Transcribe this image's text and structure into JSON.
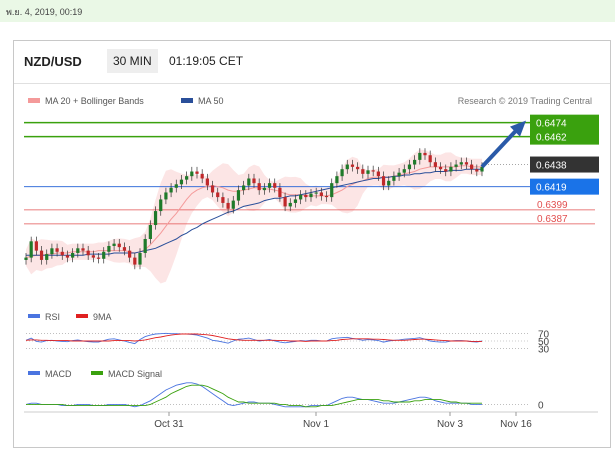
{
  "header_bar": {
    "timestamp": "พ.ย. 4, 2019, 00:19"
  },
  "panel_header": {
    "pair": "NZD/USD",
    "timeframe": "30 MIN",
    "time": "01:19:05 CET"
  },
  "colors": {
    "resistance_line": "#3aa10e",
    "level_label_green": "#3aa10e",
    "current_label": "#333333",
    "support_line": "#1f5fd6",
    "pivot_label": "#1a73e8",
    "red_level": "#e25050",
    "ma20_band": "#f49a9a",
    "ma50": "#2a4f9a",
    "candle_up": "#1f7a2a",
    "candle_down": "#c0282a",
    "rsi": "#4a74e0",
    "rsi_ma": "#e02020",
    "macd": "#4a74e0",
    "macd_signal": "#3aa10e",
    "arrow": "#2a5aa8"
  },
  "chart_data": {
    "type": "candlestick",
    "title": "NZD/USD",
    "legend": [
      "MA 20 + Bollinger Bands",
      "MA 50"
    ],
    "credit": "Research © 2019 Trading Central",
    "x_ticks": [
      "Oct 31",
      "Nov 1",
      "Nov 3",
      "Nov 16"
    ],
    "price_levels": [
      {
        "value": 0.6474,
        "label": "0.6474",
        "style": "green-line-label"
      },
      {
        "value": 0.6462,
        "label": "0.6462",
        "style": "green-line-label"
      },
      {
        "value": 0.6438,
        "label": "0.6438",
        "style": "current-dark-label"
      },
      {
        "value": 0.6419,
        "label": "0.6419",
        "style": "blue-line-label"
      },
      {
        "value": 0.6399,
        "label": "0.6399",
        "style": "red-line-text"
      },
      {
        "value": 0.6387,
        "label": "0.6387",
        "style": "red-line-text"
      }
    ],
    "price_range": [
      0.6325,
      0.6478
    ],
    "close": [
      0.6358,
      0.6372,
      0.6364,
      0.6356,
      0.6361,
      0.6366,
      0.6363,
      0.636,
      0.6358,
      0.6362,
      0.6366,
      0.6364,
      0.636,
      0.6358,
      0.6357,
      0.6363,
      0.6368,
      0.637,
      0.6367,
      0.6364,
      0.6358,
      0.6352,
      0.6362,
      0.6374,
      0.6386,
      0.6398,
      0.6408,
      0.6414,
      0.6418,
      0.6421,
      0.6425,
      0.6428,
      0.6432,
      0.643,
      0.6426,
      0.642,
      0.6414,
      0.641,
      0.6405,
      0.64,
      0.6407,
      0.6416,
      0.642,
      0.6426,
      0.6422,
      0.6416,
      0.6418,
      0.6422,
      0.6418,
      0.641,
      0.6402,
      0.6405,
      0.6408,
      0.6412,
      0.641,
      0.6413,
      0.6414,
      0.6411,
      0.641,
      0.6422,
      0.6428,
      0.6434,
      0.6438,
      0.6436,
      0.6434,
      0.643,
      0.6433,
      0.6432,
      0.6428,
      0.642,
      0.6424,
      0.6428,
      0.6431,
      0.6434,
      0.6438,
      0.6442,
      0.6448,
      0.6446,
      0.644,
      0.6436,
      0.6434,
      0.6432,
      0.6436,
      0.6438,
      0.644,
      0.6438,
      0.6434,
      0.6432,
      0.6436
    ],
    "ma20": [
      0.6358,
      0.6359,
      0.636,
      0.636,
      0.6361,
      0.6361,
      0.6362,
      0.6362,
      0.6362,
      0.6363,
      0.6363,
      0.6363,
      0.6363,
      0.6363,
      0.6364,
      0.6364,
      0.6364,
      0.6364,
      0.6364,
      0.6364,
      0.6363,
      0.6362,
      0.6363,
      0.6365,
      0.6369,
      0.6374,
      0.6379,
      0.6385,
      0.6391,
      0.6396,
      0.6402,
      0.6408,
      0.6413,
      0.6416,
      0.6418,
      0.6419,
      0.642,
      0.6419,
      0.6418,
      0.6416,
      0.6415,
      0.6415,
      0.6416,
      0.6417,
      0.6418,
      0.6418,
      0.6417,
      0.6417,
      0.6416,
      0.6415,
      0.6413,
      0.6412,
      0.6412,
      0.6412,
      0.6411,
      0.6411,
      0.6411,
      0.6411,
      0.6411,
      0.6412,
      0.6414,
      0.6416,
      0.6419,
      0.6421,
      0.6423,
      0.6424,
      0.6426,
      0.6427,
      0.6427,
      0.6427,
      0.6427,
      0.6428,
      0.6429,
      0.643,
      0.6431,
      0.6432,
      0.6434,
      0.6435,
      0.6436,
      0.6436,
      0.6436,
      0.6436,
      0.6436,
      0.6436,
      0.6437,
      0.6437,
      0.6436,
      0.6436,
      0.6436
    ],
    "ma50": [
      0.636,
      0.636,
      0.636,
      0.636,
      0.636,
      0.636,
      0.636,
      0.636,
      0.636,
      0.636,
      0.636,
      0.636,
      0.6361,
      0.6361,
      0.6361,
      0.6361,
      0.6361,
      0.6362,
      0.6362,
      0.6362,
      0.6362,
      0.6362,
      0.6363,
      0.6364,
      0.6365,
      0.6366,
      0.6368,
      0.637,
      0.6372,
      0.6374,
      0.6377,
      0.6379,
      0.6382,
      0.6384,
      0.6387,
      0.6389,
      0.6391,
      0.6393,
      0.6395,
      0.6397,
      0.6398,
      0.64,
      0.6402,
      0.6403,
      0.6404,
      0.6405,
      0.6407,
      0.6408,
      0.6409,
      0.6409,
      0.641,
      0.6411,
      0.6411,
      0.6412,
      0.6413,
      0.6414,
      0.6415,
      0.6416,
      0.6417,
      0.6418,
      0.6419,
      0.642,
      0.6421,
      0.6422,
      0.6423,
      0.6424,
      0.6425,
      0.6426,
      0.6426,
      0.6427,
      0.6427,
      0.6428,
      0.6428,
      0.6429,
      0.6429,
      0.643,
      0.643,
      0.6431,
      0.6431,
      0.6432,
      0.6432,
      0.6432,
      0.6433,
      0.6433,
      0.6433,
      0.6434,
      0.6434,
      0.6434,
      0.6434
    ],
    "forecast_target": 0.6474,
    "rsi": {
      "legend": [
        "RSI",
        "9MA"
      ],
      "levels": [
        "70",
        "50",
        "30"
      ],
      "range": [
        20,
        80
      ],
      "values": [
        52,
        58,
        49,
        47,
        51,
        52,
        50,
        49,
        48,
        51,
        53,
        50,
        48,
        47,
        47,
        51,
        55,
        56,
        53,
        50,
        46,
        43,
        54,
        62,
        66,
        69,
        70,
        71,
        70,
        70,
        69,
        69,
        68,
        66,
        62,
        58,
        52,
        50,
        47,
        44,
        50,
        55,
        56,
        58,
        54,
        50,
        52,
        54,
        50,
        47,
        45,
        47,
        49,
        51,
        50,
        52,
        52,
        50,
        50,
        56,
        58,
        59,
        60,
        57,
        55,
        52,
        54,
        53,
        51,
        47,
        50,
        52,
        53,
        55,
        56,
        57,
        59,
        55,
        50,
        48,
        47,
        47,
        50,
        51,
        51,
        50,
        48,
        47,
        50
      ],
      "ma_values": [
        52,
        53,
        53,
        52,
        52,
        51,
        51,
        51,
        51,
        50,
        50,
        50,
        50,
        50,
        50,
        50,
        50,
        51,
        51,
        51,
        51,
        50,
        51,
        53,
        56,
        59,
        61,
        64,
        66,
        68,
        69,
        69,
        69,
        69,
        68,
        67,
        65,
        62,
        59,
        56,
        54,
        53,
        52,
        52,
        52,
        52,
        52,
        52,
        52,
        51,
        51,
        50,
        50,
        50,
        49,
        50,
        50,
        50,
        50,
        51,
        52,
        54,
        55,
        56,
        56,
        56,
        56,
        55,
        55,
        54,
        53,
        52,
        52,
        52,
        53,
        54,
        55,
        55,
        54,
        53,
        52,
        51,
        50,
        50,
        50,
        50,
        49,
        49,
        49
      ]
    },
    "macd": {
      "legend": [
        "MACD",
        "MACD Signal"
      ],
      "levels": [
        "0"
      ],
      "range": [
        -0.0008,
        0.0022
      ],
      "values": [
        0.0,
        0.0001,
        0.0001,
        0.0,
        0.0,
        0.0,
        0.0,
        -0.0001,
        -0.0001,
        -0.0001,
        0.0,
        0.0,
        0.0,
        -0.0001,
        -0.0001,
        -0.0001,
        0.0,
        0.0,
        0.0,
        0.0,
        -0.0001,
        -0.0002,
        -0.0001,
        0.0001,
        0.0003,
        0.0006,
        0.0009,
        0.0012,
        0.0014,
        0.0016,
        0.0017,
        0.0018,
        0.0018,
        0.0017,
        0.0015,
        0.0012,
        0.0009,
        0.0006,
        0.0003,
        0.0,
        -0.0001,
        0.0,
        0.0001,
        0.0002,
        0.0002,
        0.0001,
        0.0001,
        0.0001,
        0.0,
        -0.0001,
        -0.0002,
        -0.0002,
        -0.0002,
        -0.0002,
        -0.0002,
        -0.0001,
        -0.0001,
        -0.0001,
        -0.0001,
        0.0001,
        0.0003,
        0.0005,
        0.0006,
        0.0006,
        0.0005,
        0.0004,
        0.0004,
        0.0003,
        0.0002,
        0.0001,
        0.0001,
        0.0001,
        0.0002,
        0.0003,
        0.0004,
        0.0005,
        0.0006,
        0.0006,
        0.0005,
        0.0003,
        0.0002,
        0.0001,
        0.0001,
        0.0001,
        0.0001,
        0.0001,
        0.0,
        0.0,
        0.0
      ],
      "signal": [
        0.0,
        0.0,
        0.0,
        0.0,
        0.0,
        0.0,
        0.0,
        0.0,
        -0.0001,
        -0.0001,
        -0.0001,
        -0.0001,
        -0.0001,
        -0.0001,
        -0.0001,
        -0.0001,
        -0.0001,
        -0.0001,
        -0.0001,
        -0.0001,
        -0.0001,
        -0.0001,
        -0.0001,
        -0.0001,
        0.0,
        0.0002,
        0.0004,
        0.0006,
        0.0009,
        0.0011,
        0.0013,
        0.0015,
        0.0016,
        0.0016,
        0.0016,
        0.0015,
        0.0013,
        0.0011,
        0.0009,
        0.0006,
        0.0004,
        0.0002,
        0.0002,
        0.0001,
        0.0001,
        0.0001,
        0.0001,
        0.0001,
        0.0001,
        0.0,
        0.0,
        -0.0001,
        -0.0001,
        -0.0001,
        -0.0002,
        -0.0002,
        -0.0002,
        -0.0001,
        -0.0001,
        -0.0001,
        0.0,
        0.0001,
        0.0002,
        0.0003,
        0.0004,
        0.0004,
        0.0004,
        0.0004,
        0.0004,
        0.0003,
        0.0003,
        0.0002,
        0.0002,
        0.0002,
        0.0002,
        0.0003,
        0.0003,
        0.0004,
        0.0004,
        0.0004,
        0.0004,
        0.0003,
        0.0002,
        0.0002,
        0.0001,
        0.0001,
        0.0001,
        0.0001,
        0.0001
      ]
    }
  }
}
